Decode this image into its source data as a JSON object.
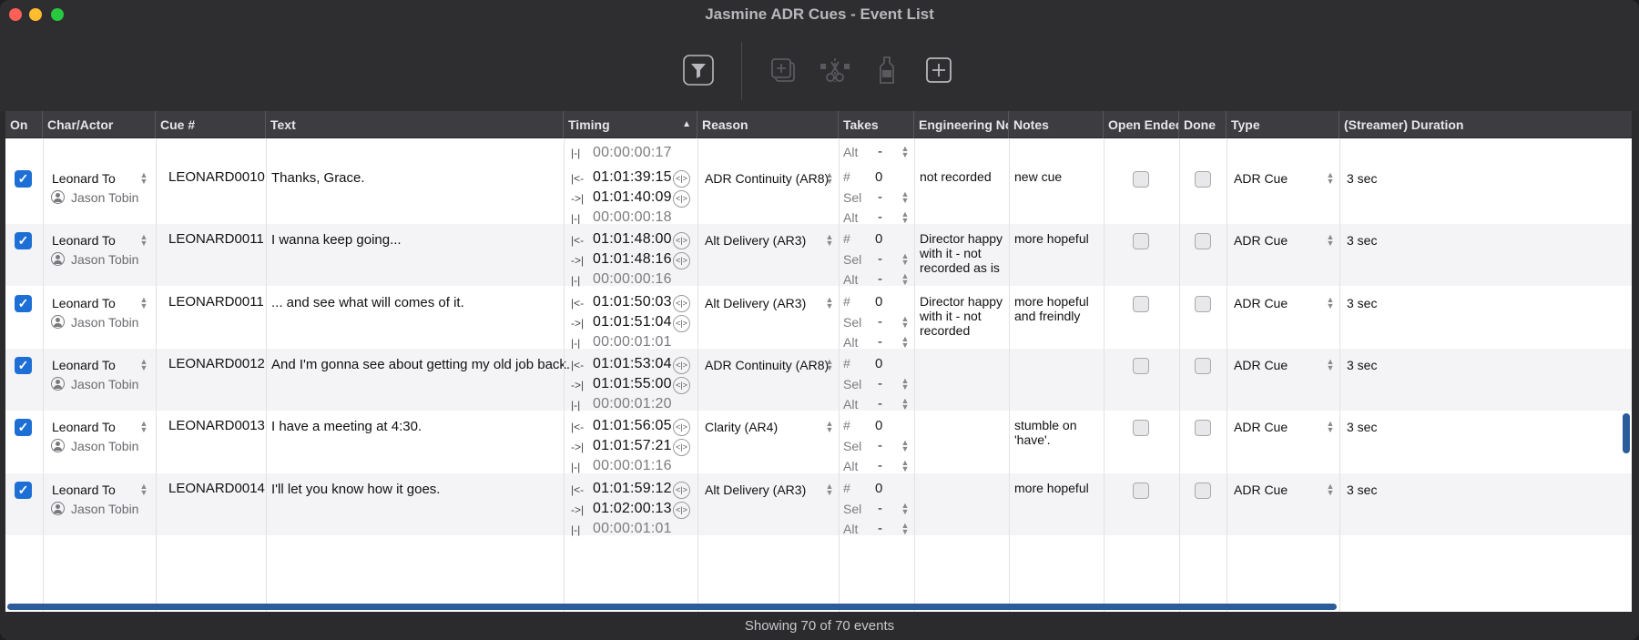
{
  "window": {
    "title": "Jasmine ADR Cues - Event List"
  },
  "toolbar": {
    "buttons": [
      {
        "name": "filter",
        "enabled": true
      },
      {
        "name": "duplicate",
        "enabled": false
      },
      {
        "name": "split",
        "enabled": false
      },
      {
        "name": "marker",
        "enabled": false
      },
      {
        "name": "add",
        "enabled": true
      }
    ]
  },
  "columns": [
    "On",
    "Char/Actor",
    "Cue #",
    "Text",
    "Timing",
    "Reason",
    "Takes",
    "Engineering Notes",
    "Notes",
    "Open Ended",
    "Done",
    "Type",
    "(Streamer) Duration"
  ],
  "partial_row": {
    "actor": "Jason Tobin",
    "duration": "00:00:00:17",
    "takes_alt": "Alt",
    "takes_alt_val": "-"
  },
  "rows": [
    {
      "character": "Leonard To",
      "actor": "Jason Tobin",
      "cue": "LEONARD0010",
      "text": "Thanks, Grace.",
      "in": "01:01:39:15",
      "out": "01:01:40:09",
      "dur": "00:00:00:18",
      "reason": "ADR Continuity (AR8)",
      "takes_num": "0",
      "sel": "-",
      "alt": "-",
      "eng": [
        "not recorded"
      ],
      "notes": [
        "new cue"
      ],
      "type": "ADR Cue",
      "streamer": "3 sec"
    },
    {
      "character": "Leonard To",
      "actor": "Jason Tobin",
      "cue": "LEONARD0011",
      "text": "I wanna keep going...",
      "in": "01:01:48:00",
      "out": "01:01:48:16",
      "dur": "00:00:00:16",
      "reason": "Alt Delivery (AR3)",
      "takes_num": "0",
      "sel": "-",
      "alt": "-",
      "eng": [
        "Director happy",
        "with it - not",
        "recorded as is"
      ],
      "notes": [
        "more hopeful"
      ],
      "type": "ADR Cue",
      "streamer": "3 sec"
    },
    {
      "character": "Leonard To",
      "actor": "Jason Tobin",
      "cue": "LEONARD0011",
      "text": "... and see what will comes of it.",
      "in": "01:01:50:03",
      "out": "01:01:51:04",
      "dur": "00:00:01:01",
      "reason": "Alt Delivery (AR3)",
      "takes_num": "0",
      "sel": "-",
      "alt": "-",
      "eng": [
        "Director happy",
        "with it - not",
        "recorded"
      ],
      "notes": [
        "more hopeful",
        "and freindly"
      ],
      "type": "ADR Cue",
      "streamer": "3 sec"
    },
    {
      "character": "Leonard To",
      "actor": "Jason Tobin",
      "cue": "LEONARD0012",
      "text": "And I'm gonna see about getting my old job back.",
      "in": "01:01:53:04",
      "out": "01:01:55:00",
      "dur": "00:00:01:20",
      "reason": "ADR Continuity (AR8)",
      "takes_num": "0",
      "sel": "-",
      "alt": "-",
      "eng": [],
      "notes": [],
      "type": "ADR Cue",
      "streamer": "3 sec"
    },
    {
      "character": "Leonard To",
      "actor": "Jason Tobin",
      "cue": "LEONARD0013",
      "text": "I have a meeting at 4:30.",
      "in": "01:01:56:05",
      "out": "01:01:57:21",
      "dur": "00:00:01:16",
      "reason": "Clarity (AR4)",
      "takes_num": "0",
      "sel": "-",
      "alt": "-",
      "eng": [],
      "notes": [
        "stumble on",
        "'have'."
      ],
      "type": "ADR Cue",
      "streamer": "3 sec"
    },
    {
      "character": "Leonard To",
      "actor": "Jason Tobin",
      "cue": "LEONARD0014",
      "text": "I'll let you know how it goes.",
      "in": "01:01:59:12",
      "out": "01:02:00:13",
      "dur": "00:00:01:01",
      "reason": "Alt Delivery (AR3)",
      "takes_num": "0",
      "sel": "-",
      "alt": "-",
      "eng": [],
      "notes": [
        "more hopeful"
      ],
      "type": "ADR Cue",
      "streamer": "3 sec"
    }
  ],
  "takes_labels": {
    "num": "#",
    "sel": "Sel",
    "alt": "Alt"
  },
  "icons": {
    "in": "|<-",
    "out": "->|",
    "dur": "|-|",
    "nudge": "<|>",
    "check": "✓"
  },
  "status": {
    "text": "Showing 70 of 70 events"
  }
}
